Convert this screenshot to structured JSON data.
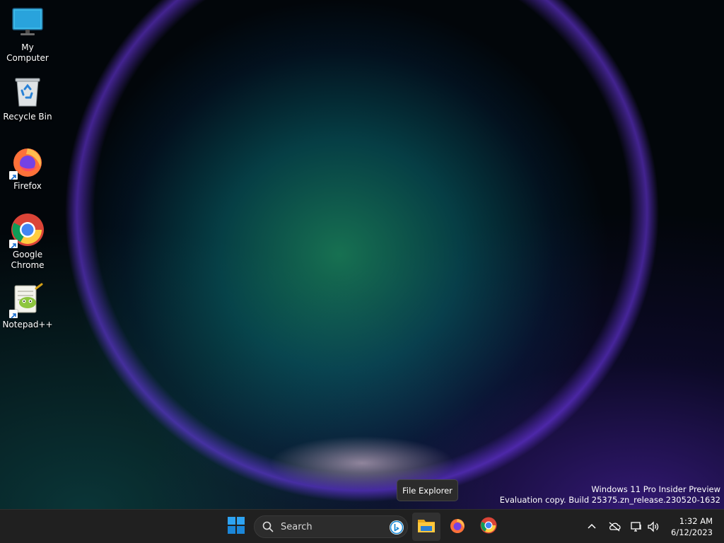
{
  "desktop": {
    "icons": [
      {
        "label_lines": [
          "My Computer"
        ]
      },
      {
        "label_lines": [
          "Recycle Bin"
        ]
      },
      {
        "label_lines": [
          "Firefox"
        ]
      },
      {
        "label_lines": [
          "Google",
          "Chrome"
        ]
      },
      {
        "label_lines": [
          "Notepad++"
        ]
      }
    ]
  },
  "tooltip": {
    "text": "File Explorer"
  },
  "watermark": {
    "line1": "Windows 11 Pro Insider Preview",
    "line2": "Evaluation copy. Build 25375.zn_release.230520-1632"
  },
  "taskbar": {
    "search": {
      "label": "Search"
    },
    "pinned": [
      {
        "icon": "file-explorer-icon",
        "active": true
      },
      {
        "icon": "firefox-icon",
        "active": false
      },
      {
        "icon": "chrome-icon",
        "active": false
      }
    ],
    "tray": {
      "icons": [
        "chevron-up-icon",
        "onedrive-offline-icon",
        "network-icon",
        "volume-icon"
      ],
      "time": "1:32 AM",
      "date": "6/12/2023"
    }
  },
  "colors": {
    "taskbar_bg": "#202020",
    "windows_blue": "#0a7bd6",
    "firefox_orange": "#ff7139"
  }
}
